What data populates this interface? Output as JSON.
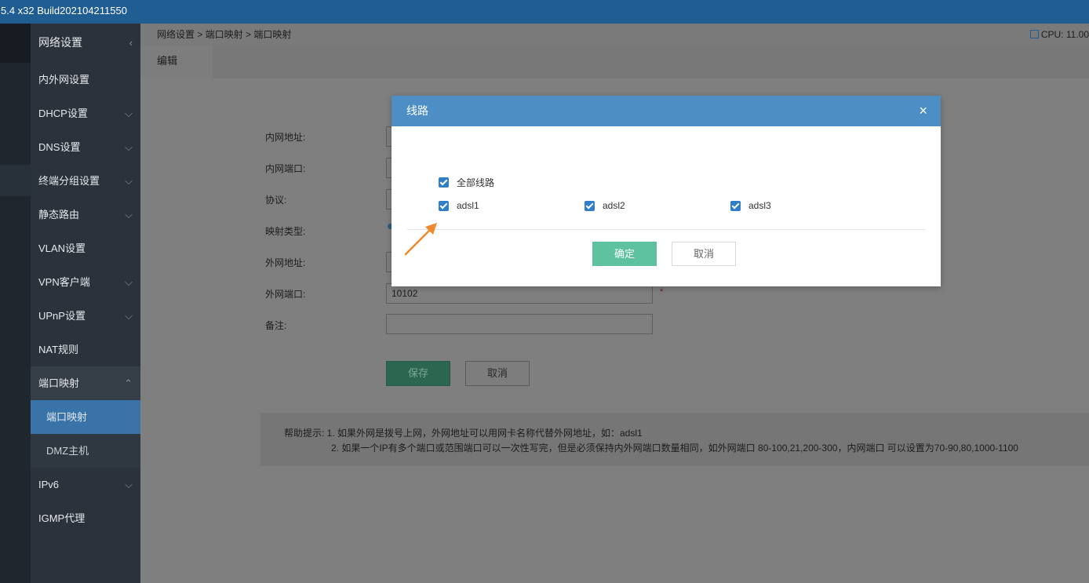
{
  "app": {
    "title": "5.4 x32 Build202104211550"
  },
  "sidebar": {
    "header": "网络设置",
    "items": [
      {
        "label": "内外网设置"
      },
      {
        "label": "DHCP设置"
      },
      {
        "label": "DNS设置"
      },
      {
        "label": "终端分组设置"
      },
      {
        "label": "静态路由"
      },
      {
        "label": "VLAN设置"
      },
      {
        "label": "VPN客户端"
      },
      {
        "label": "UPnP设置"
      },
      {
        "label": "NAT规则"
      },
      {
        "label": "端口映射"
      },
      {
        "label": "端口映射"
      },
      {
        "label": "DMZ主机"
      },
      {
        "label": "IPv6"
      },
      {
        "label": "IGMP代理"
      }
    ]
  },
  "breadcrumb": "网络设置 > 端口映射 > 端口映射",
  "status": {
    "cpu": "CPU: 11.00"
  },
  "tab": {
    "edit": "编辑"
  },
  "form": {
    "inner_addr_label": "内网地址:",
    "inner_port_label": "内网端口:",
    "protocol_label": "协议:",
    "map_type_label": "映射类型:",
    "outer_addr_label": "外网地址:",
    "outer_port_label": "外网端口:",
    "outer_port_value": "10102",
    "note_label": "备注:",
    "required_mark": "*",
    "save": "保存",
    "cancel": "取消"
  },
  "help": {
    "line1": "帮助提示: 1. 如果外网是拨号上网，外网地址可以用网卡名称代替外网地址，如：adsl1",
    "line2": "2. 如果一个IP有多个端口或范围端口可以一次性写完，但是必须保持内外网端口数量相同，如外网端口 80-100,21,200-300，内网端口 可以设置为70-90,80,1000-1100"
  },
  "modal": {
    "title": "线路",
    "close": "×",
    "all_lines": "全部线路",
    "lines": [
      "adsl1",
      "adsl2",
      "adsl3"
    ],
    "ok": "确定",
    "cancel": "取消"
  },
  "colors": {
    "topbar": "#1f5d93",
    "modal_header": "#4d8fc5",
    "ok_button": "#5ec2a0",
    "checkbox": "#2f7ec7",
    "arrow": "#f08a2e"
  }
}
